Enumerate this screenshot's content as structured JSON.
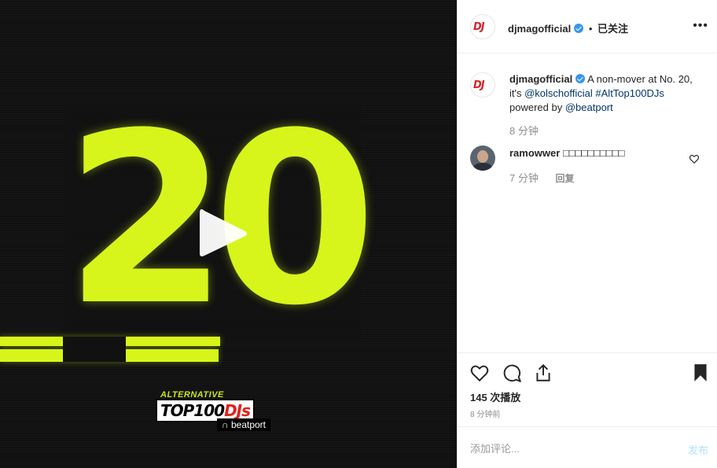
{
  "media": {
    "number": "20",
    "logo_alt": "ALTERNATIVE",
    "logo_main": "TOP100",
    "logo_dj": "DJs",
    "logo_beatport": "beatport",
    "accent_color": "#d7f51a",
    "play_icon": "play-icon"
  },
  "header": {
    "avatar_text": "DJ",
    "username": "djmagofficial",
    "separator": "•",
    "follow_status": "已关注",
    "more_icon": "more-horizontal-icon"
  },
  "caption": {
    "avatar_text": "DJ",
    "username": "djmagofficial",
    "text1": "A non-mover at No. 20, it's",
    "mention1": "@kolschofficial",
    "hashtag": "#AltTop100DJs",
    "text2": "powered by",
    "mention2": "@beatport",
    "time": "8 分钟"
  },
  "comments": [
    {
      "username": "ramowwer",
      "text": "□□□□□□□□□□",
      "time": "7 分钟",
      "reply_label": "回复"
    }
  ],
  "actions": {
    "views": "145 次播放",
    "time_ago": "8 分钟前"
  },
  "comment_box": {
    "placeholder": "添加评论...",
    "post_label": "发布"
  }
}
